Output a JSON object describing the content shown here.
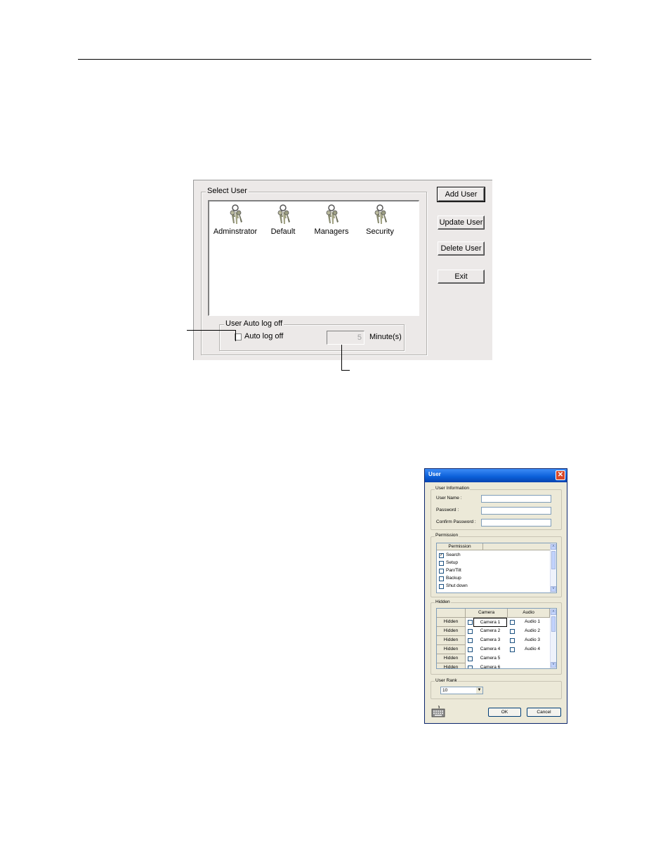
{
  "select_user_dialog": {
    "group_label": "Select User",
    "users": [
      {
        "label": "Adminstrator",
        "icon": "keys-icon"
      },
      {
        "label": "Default",
        "icon": "keys-icon"
      },
      {
        "label": "Managers",
        "icon": "keys-icon"
      },
      {
        "label": "Security",
        "icon": "keys-icon"
      }
    ],
    "buttons": {
      "add_user": "Add User",
      "update_user": "Update User",
      "delete_user": "Delete User",
      "exit": "Exit"
    },
    "auto_logoff": {
      "group_label": "User Auto log off",
      "checkbox_label": "Auto log off",
      "checked": false,
      "minutes_value": "5",
      "unit_label": "Minute(s)"
    }
  },
  "user_dialog": {
    "title": "User",
    "user_information": {
      "group_label": "User Information",
      "user_name_label": "User Name :",
      "password_label": "Password :",
      "confirm_password_label": "Confirm Password :",
      "user_name_value": "",
      "password_value": "",
      "confirm_password_value": ""
    },
    "permission": {
      "group_label": "Permission",
      "column_header": "Permission",
      "items": [
        {
          "label": "Search",
          "checked": true
        },
        {
          "label": "Setup",
          "checked": false
        },
        {
          "label": "Pan/Tilt",
          "checked": false
        },
        {
          "label": "Backup",
          "checked": false
        },
        {
          "label": "Shut down",
          "checked": false
        }
      ]
    },
    "hidden": {
      "group_label": "Hidden",
      "columns": [
        "Camera",
        "Audio"
      ],
      "rows": [
        {
          "row_label": "Hidden",
          "camera": "Camera 1",
          "audio": "Audio 1"
        },
        {
          "row_label": "Hidden",
          "camera": "Camera 2",
          "audio": "Audio 2"
        },
        {
          "row_label": "Hidden",
          "camera": "Camera 3",
          "audio": "Audio 3"
        },
        {
          "row_label": "Hidden",
          "camera": "Camera 4",
          "audio": "Audio 4"
        },
        {
          "row_label": "Hidden",
          "camera": "Camera 5",
          "audio": ""
        },
        {
          "row_label": "Hidden",
          "camera": "Camera 6",
          "audio": ""
        }
      ]
    },
    "user_rank": {
      "group_label": "User Rank",
      "selected": "10"
    },
    "buttons": {
      "ok": "OK",
      "cancel": "Cancel"
    },
    "keyboard_icon": "keyboard-icon"
  }
}
